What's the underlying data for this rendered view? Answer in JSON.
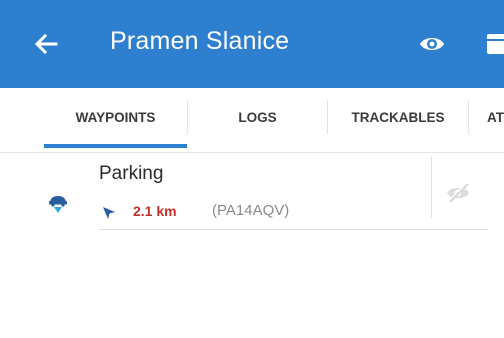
{
  "app_bar": {
    "title": "Pramen Slanice",
    "back_icon": "arrow-left-icon",
    "actions": [
      {
        "icon": "eye-icon"
      },
      {
        "icon": "folder-icon"
      }
    ]
  },
  "tabs": [
    {
      "label": "WAYPOINTS",
      "active": true
    },
    {
      "label": "LOGS",
      "active": false
    },
    {
      "label": "TRACKABLES",
      "active": false
    },
    {
      "label": "AT",
      "active": false
    }
  ],
  "waypoints": [
    {
      "icon": "parking-car-icon",
      "name": "Parking",
      "distance": "2.1 km",
      "code": "(PA14AQV)",
      "visibility_icon": "eye-off-icon"
    }
  ],
  "colors": {
    "app_bar": "#2f7fd0",
    "tab_indicator": "#2f7fd0",
    "distance": "#c0302b",
    "code": "#8a8a8a",
    "waypoint_icon": "#2a5d9f"
  }
}
